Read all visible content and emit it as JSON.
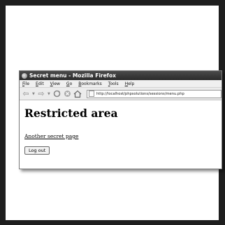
{
  "window": {
    "title": "Secret menu - Mozilla Firefox"
  },
  "menubar": {
    "items": [
      "File",
      "Edit",
      "View",
      "Go",
      "Bookmarks",
      "Tools",
      "Help"
    ]
  },
  "toolbar": {
    "url": "http://localhost/phpsolutions/sessions/menu.php"
  },
  "content": {
    "heading": "Restricted area",
    "link_label": "Another secret page",
    "logout_label": "Log out"
  }
}
